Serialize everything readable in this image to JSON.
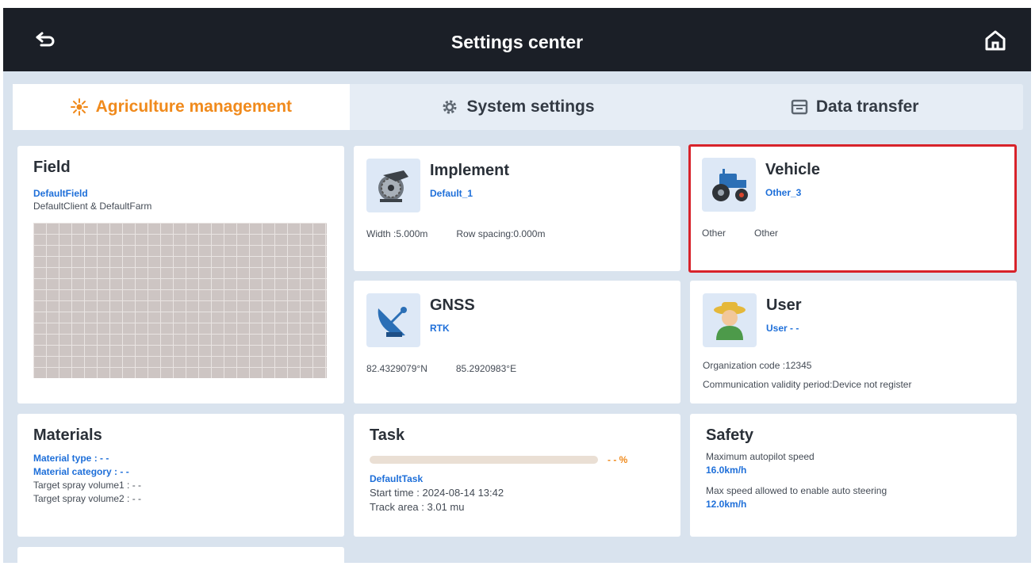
{
  "topbar": {
    "title": "Settings center",
    "back_icon": "back-arrow-icon",
    "home_icon": "home-icon"
  },
  "tabs": [
    {
      "label": "Agriculture management",
      "icon": "agriculture-icon",
      "active": true
    },
    {
      "label": "System settings",
      "icon": "gear-icon",
      "active": false
    },
    {
      "label": "Data transfer",
      "icon": "data-transfer-icon",
      "active": false
    }
  ],
  "colors": {
    "accent": "#f08a1c",
    "link_blue": "#1e6fd9",
    "topbar": "#1b1f27",
    "selected_border": "#d8232a"
  },
  "field": {
    "title": "Field",
    "name": "DefaultField",
    "client_farm": "DefaultClient & DefaultFarm"
  },
  "implement": {
    "title": "Implement",
    "name": "Default_1",
    "width": "Width :5.000m",
    "row_spacing": "Row spacing:0.000m"
  },
  "vehicle": {
    "title": "Vehicle",
    "name": "Other_3",
    "type1": "Other",
    "type2": "Other",
    "selected": true
  },
  "gnss": {
    "title": "GNSS",
    "mode": "RTK",
    "lat": "82.4329079°N",
    "lon": "85.2920983°E"
  },
  "user": {
    "title": "User",
    "name": "User - -",
    "org_code": "Organization code :12345",
    "validity": "Communication validity period:Device not register"
  },
  "materials": {
    "title": "Materials",
    "type": "Material type : - -",
    "category": "Material category : - -",
    "spray1": "Target spray volume1 : - -",
    "spray2": "Target spray volume2 : - -"
  },
  "task": {
    "title": "Task",
    "progress_text": "- - %",
    "progress_value": 0,
    "name": "DefaultTask",
    "start_time": "Start time : 2024-08-14 13:42",
    "track_area": "Track area : 3.01 mu"
  },
  "safety": {
    "title": "Safety",
    "max_autopilot_label": "Maximum autopilot speed",
    "max_autopilot_value": "16.0km/h",
    "max_auto_steer_label": "Max speed allowed to enable auto steering",
    "max_auto_steer_value": "12.0km/h"
  }
}
